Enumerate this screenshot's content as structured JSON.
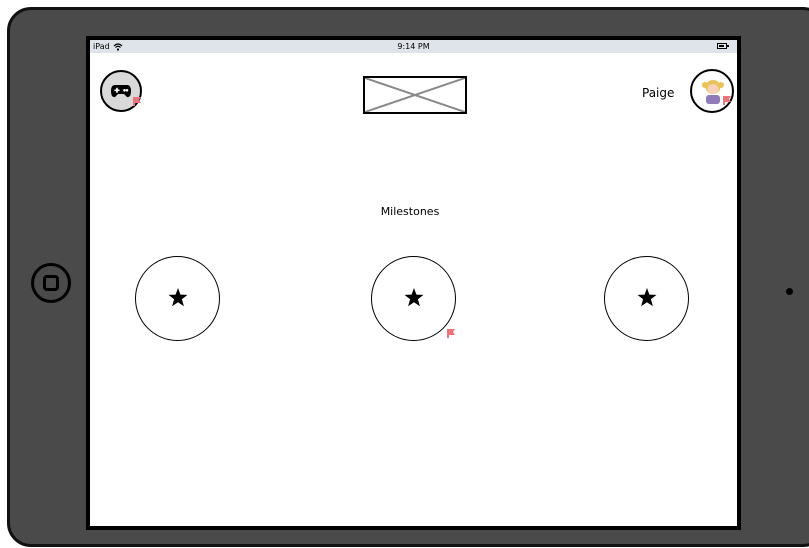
{
  "status_bar": {
    "carrier": "iPad",
    "time": "9:14 PM"
  },
  "header": {
    "user_name": "Paige"
  },
  "main": {
    "title": "Milestones",
    "milestones": [
      {
        "icon": "star-icon"
      },
      {
        "icon": "star-icon"
      },
      {
        "icon": "star-icon"
      }
    ]
  },
  "colors": {
    "device_frame": "#4a4a4a",
    "status_bar": "#dfe3ea",
    "flag_marker": "#e8747c"
  }
}
